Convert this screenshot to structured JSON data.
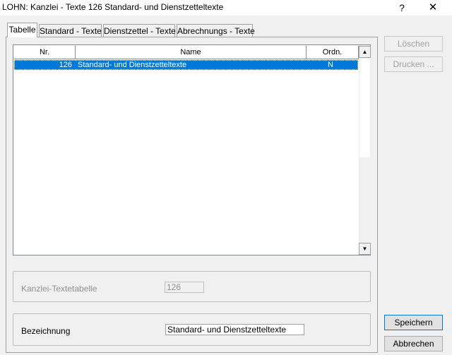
{
  "window": {
    "title": "LOHN: Kanzlei - Texte  126  Standard- und Dienstzetteltexte",
    "help_label": "?",
    "close_label": "✕"
  },
  "tabs": [
    {
      "label": "Tabelle",
      "active": true
    },
    {
      "label": "Standard - Texte",
      "active": false
    },
    {
      "label": "Dienstzettel - Texte",
      "active": false
    },
    {
      "label": "Abrechnungs - Texte",
      "active": false
    }
  ],
  "table": {
    "columns": [
      "Nr.",
      "Name",
      "Ordn."
    ],
    "rows": [
      {
        "nr": "126",
        "name": "Standard- und Dienstzetteltexte",
        "ordn": "N",
        "selected": true
      }
    ],
    "scroll_up": "▲",
    "scroll_down": "▼"
  },
  "fields": {
    "kanzlei_label": "Kanzlei-Textetabelle",
    "kanzlei_value": "126",
    "bezeichnung_label": "Bezeichnung",
    "bezeichnung_value": "Standard- und Dienstzetteltexte"
  },
  "buttons": {
    "loeschen": "Löschen",
    "drucken": "Drucken ...",
    "speichern": "Speichern",
    "abbrechen": "Abbrechen"
  },
  "colors": {
    "selection": "#0078d7",
    "background": "#f0f0f0"
  }
}
